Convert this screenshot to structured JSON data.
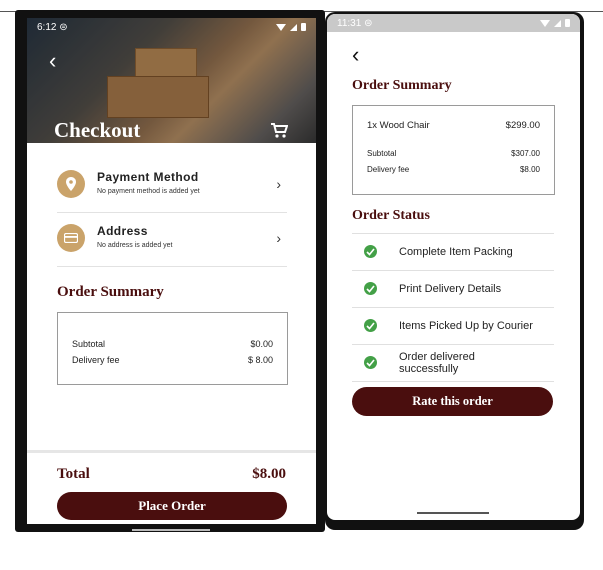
{
  "left": {
    "status_time": "6:12",
    "title": "Checkout",
    "payment": {
      "title": "Payment Method",
      "subtitle": "No payment method is added yet"
    },
    "address": {
      "title": "Address",
      "subtitle": "No address is added yet"
    },
    "order_summary_title": "Order Summary",
    "summary": [
      {
        "label": "Subtotal",
        "value": "$0.00"
      },
      {
        "label": "Delivery fee",
        "value": "$ 8.00"
      }
    ],
    "total_label": "Total",
    "total_value": "$8.00",
    "place_order_label": "Place Order"
  },
  "right": {
    "status_time": "11:31",
    "order_summary_title": "Order Summary",
    "item": {
      "name": "1x Wood Chair",
      "price": "$299.00"
    },
    "summary": [
      {
        "label": "Subtotal",
        "value": "$307.00"
      },
      {
        "label": "Delivery fee",
        "value": "$8.00"
      }
    ],
    "order_status_title": "Order Status",
    "statuses": [
      "Complete Item Packing",
      "Print Delivery Details",
      "Items Picked Up by Courier",
      "Order delivered successfully"
    ],
    "rate_label": "Rate this order"
  },
  "colors": {
    "accent": "#4a0e0e",
    "icon_circle": "#caa36a",
    "check": "#43a047"
  }
}
